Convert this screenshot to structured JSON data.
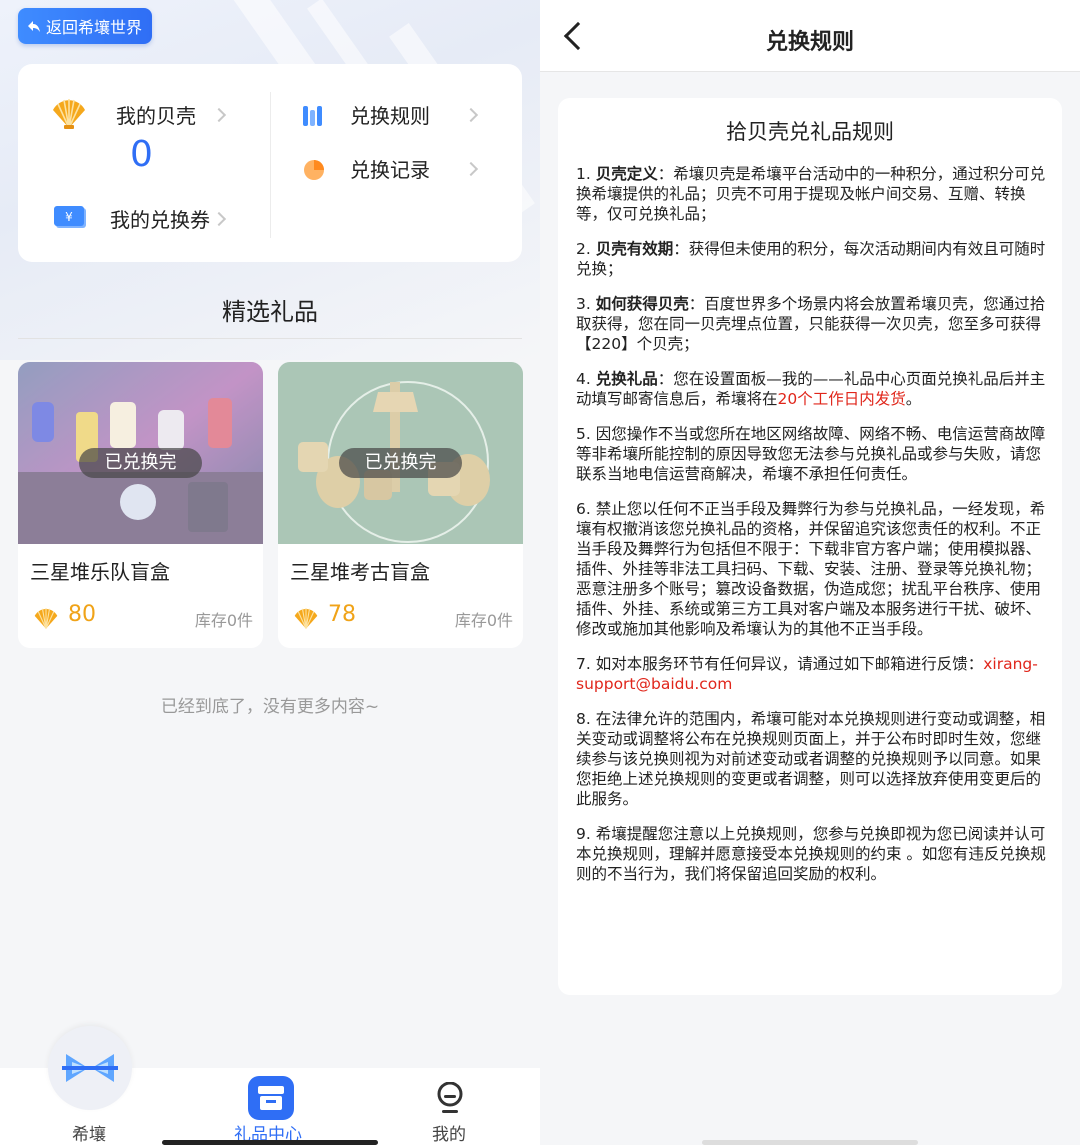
{
  "left": {
    "back_label": "返回希壤世界",
    "shells_label": "我的贝壳",
    "shells_count": "0",
    "vouchers_label": "我的兑换券",
    "rules_label": "兑换规则",
    "records_label": "兑换记录",
    "section_title": "精选礼品",
    "gifts": [
      {
        "badge": "已兑换完",
        "name": "三星堆乐队盲盒",
        "price": "80",
        "stock": "库存0件"
      },
      {
        "badge": "已兑换完",
        "name": "三星堆考古盲盒",
        "price": "78",
        "stock": "库存0件"
      }
    ],
    "bottom_note": "已经到底了，没有更多内容~",
    "tabs": [
      {
        "label": "希壤"
      },
      {
        "label": "礼品中心"
      },
      {
        "label": "我的"
      }
    ],
    "colors": {
      "accent": "#2f6ef5",
      "price": "#f0a318"
    }
  },
  "right": {
    "header_title": "兑换规则",
    "rules_title": "拾贝壳兑礼品规则",
    "rules": [
      {
        "prefix": "1. ",
        "bold": "贝壳定义",
        "text": "：希壤贝壳是希壤平台活动中的一种积分，通过积分可兑换希壤提供的礼品；贝壳不可用于提现及帐户间交易、互赠、转换等，仅可兑换礼品；"
      },
      {
        "prefix": "2. ",
        "bold": "贝壳有效期",
        "text": "：获得但未使用的积分，每次活动期间内有效且可随时兑换；"
      },
      {
        "prefix": "3. ",
        "bold": "如何获得贝壳",
        "text": "：百度世界多个场景内将会放置希壤贝壳，您通过拾取获得，您在同一贝壳埋点位置，只能获得一次贝壳，您至多可获得【220】个贝壳；"
      },
      {
        "prefix": "4. ",
        "bold": "兑换礼品",
        "text": "：您在设置面板—我的——礼品中心页面兑换礼品后并主动填写邮寄信息后，希壤将在",
        "red": "20个工作日内发货",
        "tail": "。"
      },
      {
        "prefix": "5. ",
        "bold": "",
        "text": "因您操作不当或您所在地区网络故障、网络不畅、电信运营商故障等非希壤所能控制的原因导致您无法参与兑换礼品或参与失败，请您联系当地电信运营商解决，希壤不承担任何责任。"
      },
      {
        "prefix": "6. ",
        "bold": "",
        "text": "禁止您以任何不正当手段及舞弊行为参与兑换礼品，一经发现，希壤有权撤消该您兑换礼品的资格，并保留追究该您责任的权利。不正当手段及舞弊行为包括但不限于：下载非官方客户端；使用模拟器、插件、外挂等非法工具扫码、下载、安装、注册、登录等兑换礼物；恶意注册多个账号；篡改设备数据，伪造成您；扰乱平台秩序、使用插件、外挂、系统或第三方工具对客户端及本服务进行干扰、破坏、修改或施加其他影响及希壤认为的其他不正当手段。"
      },
      {
        "prefix": "7. ",
        "bold": "",
        "text": "如对本服务环节有任何异议，请通过如下邮箱进行反馈：",
        "red": "xirang-support@baidu.com",
        "tail": ""
      },
      {
        "prefix": "8. ",
        "bold": "",
        "text": "在法律允许的范围内，希壤可能对本兑换规则进行变动或调整，相关变动或调整将公布在兑换规则页面上，并于公布时即时生效，您继续参与该兑换则视为对前述变动或者调整的兑换规则予以同意。如果您拒绝上述兑换规则的变更或者调整，则可以选择放弃使用变更后的此服务。"
      },
      {
        "prefix": "9. ",
        "bold": "",
        "text": "希壤提醒您注意以上兑换规则，您参与兑换即视为您已阅读并认可本兑换规则，理解并愿意接受本兑换规则的约束 。如您有违反兑换规则的不当行为，我们将保留追回奖励的权利。"
      }
    ]
  }
}
